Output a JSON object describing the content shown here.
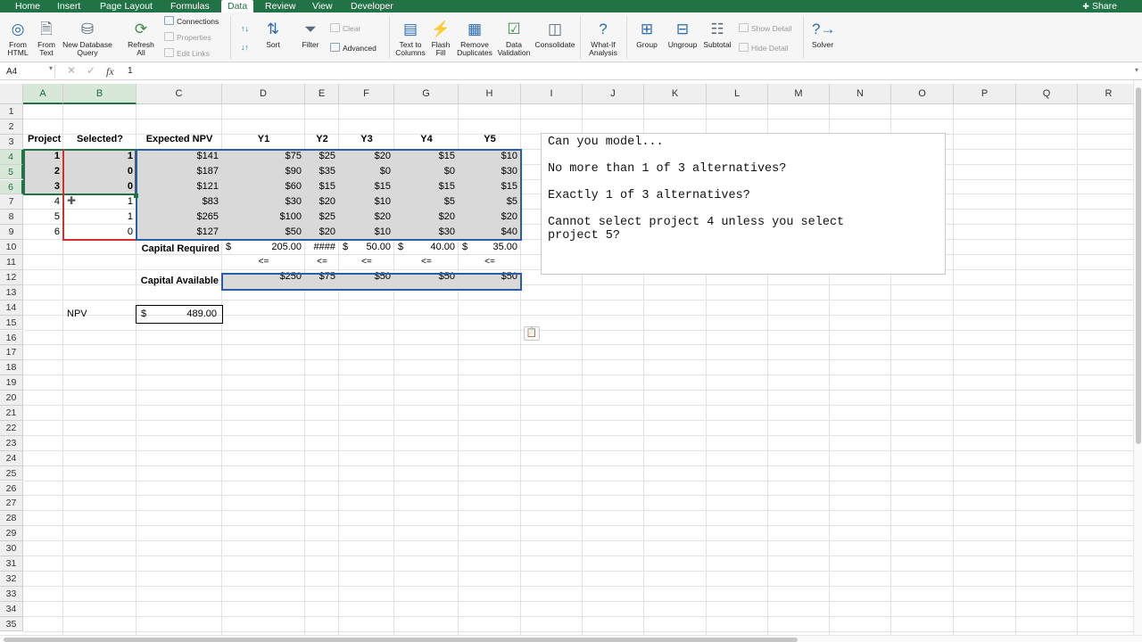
{
  "ribbon_tabs": [
    "Home",
    "Insert",
    "Page Layout",
    "Formulas",
    "Data",
    "Review",
    "View",
    "Developer"
  ],
  "active_tab": "Data",
  "share_label": "Share",
  "ribbon": {
    "from_html": [
      "From",
      "HTML"
    ],
    "from_text": [
      "From",
      "Text"
    ],
    "new_db_query": [
      "New Database",
      "Query"
    ],
    "refresh_all": [
      "Refresh",
      "All"
    ],
    "connections": "Connections",
    "properties": "Properties",
    "edit_links": "Edit Links",
    "sort": "Sort",
    "filter": "Filter",
    "clear": "Clear",
    "advanced": "Advanced",
    "text_to_columns": [
      "Text to",
      "Columns"
    ],
    "flash_fill": [
      "Flash",
      "Fill"
    ],
    "remove_duplicates": [
      "Remove",
      "Duplicates"
    ],
    "data_validation": [
      "Data",
      "Validation"
    ],
    "consolidate": "Consolidate",
    "what_if": [
      "What-If",
      "Analysis"
    ],
    "group": "Group",
    "ungroup": "Ungroup",
    "subtotal": "Subtotal",
    "show_detail": "Show Detail",
    "hide_detail": "Hide Detail",
    "solver": "Solver"
  },
  "formula_bar": {
    "name_box": "A4",
    "fx": "fx",
    "value": "1"
  },
  "columns": [
    "A",
    "B",
    "C",
    "D",
    "E",
    "F",
    "G",
    "H",
    "I",
    "J",
    "K",
    "L",
    "M",
    "N",
    "O",
    "P",
    "Q",
    "R"
  ],
  "selected_columns": [
    "A",
    "B"
  ],
  "rows": [
    "1",
    "2",
    "3",
    "4",
    "5",
    "6",
    "7",
    "8",
    "9",
    "10",
    "11",
    "12",
    "13",
    "14",
    "15",
    "16",
    "17",
    "18",
    "19",
    "20",
    "21",
    "22",
    "23",
    "24",
    "25",
    "26",
    "27",
    "28",
    "29",
    "30",
    "31",
    "32",
    "33",
    "34",
    "35"
  ],
  "selected_rows": [
    "4",
    "5",
    "6"
  ],
  "headers": {
    "project": "Project",
    "selected": "Selected?",
    "expected_npv": "Expected NPV",
    "years": [
      "Y1",
      "Y2",
      "Y3",
      "Y4",
      "Y5"
    ]
  },
  "projects": [
    {
      "project": "1",
      "selected": "1",
      "npv": "$141",
      "y": [
        "$75",
        "$25",
        "$20",
        "$15",
        "$10"
      ]
    },
    {
      "project": "2",
      "selected": "0",
      "npv": "$187",
      "y": [
        "$90",
        "$35",
        "$0",
        "$0",
        "$30"
      ]
    },
    {
      "project": "3",
      "selected": "0",
      "npv": "$121",
      "y": [
        "$60",
        "$15",
        "$15",
        "$15",
        "$15"
      ]
    },
    {
      "project": "4",
      "selected": "1",
      "npv": "$83",
      "y": [
        "$30",
        "$20",
        "$10",
        "$5",
        "$5"
      ]
    },
    {
      "project": "5",
      "selected": "1",
      "npv": "$265",
      "y": [
        "$100",
        "$25",
        "$20",
        "$20",
        "$20"
      ]
    },
    {
      "project": "6",
      "selected": "0",
      "npv": "$127",
      "y": [
        "$50",
        "$20",
        "$10",
        "$30",
        "$40"
      ]
    }
  ],
  "capital_required": {
    "label": "Capital Required",
    "values": [
      {
        "sym": "$",
        "val": "205.00"
      },
      {
        "sym": "",
        "val": "####"
      },
      {
        "sym": "$",
        "val": "50.00"
      },
      {
        "sym": "$",
        "val": "40.00"
      },
      {
        "sym": "$",
        "val": "35.00"
      }
    ]
  },
  "constraint_ops": [
    "<=",
    "<=",
    "<=",
    "<=",
    "<="
  ],
  "capital_available": {
    "label": "Capital Available",
    "values": [
      "$250",
      "$75",
      "$50",
      "$50",
      "$50"
    ]
  },
  "npv_total": {
    "label": "NPV",
    "sym": "$",
    "value": "489.00"
  },
  "text_box": {
    "lines": [
      "Can you model...",
      "No more than 1 of 3 alternatives?",
      "Exactly 1 of 3 alternatives?",
      "Cannot select project 4 unless you select",
      "project 5?"
    ]
  },
  "colors": {
    "excel_green": "#217346",
    "selection_green": "#217346",
    "red_border": "#d32f2f",
    "blue_border": "#2a5fa8",
    "cell_fill": "#d9d9d9"
  }
}
